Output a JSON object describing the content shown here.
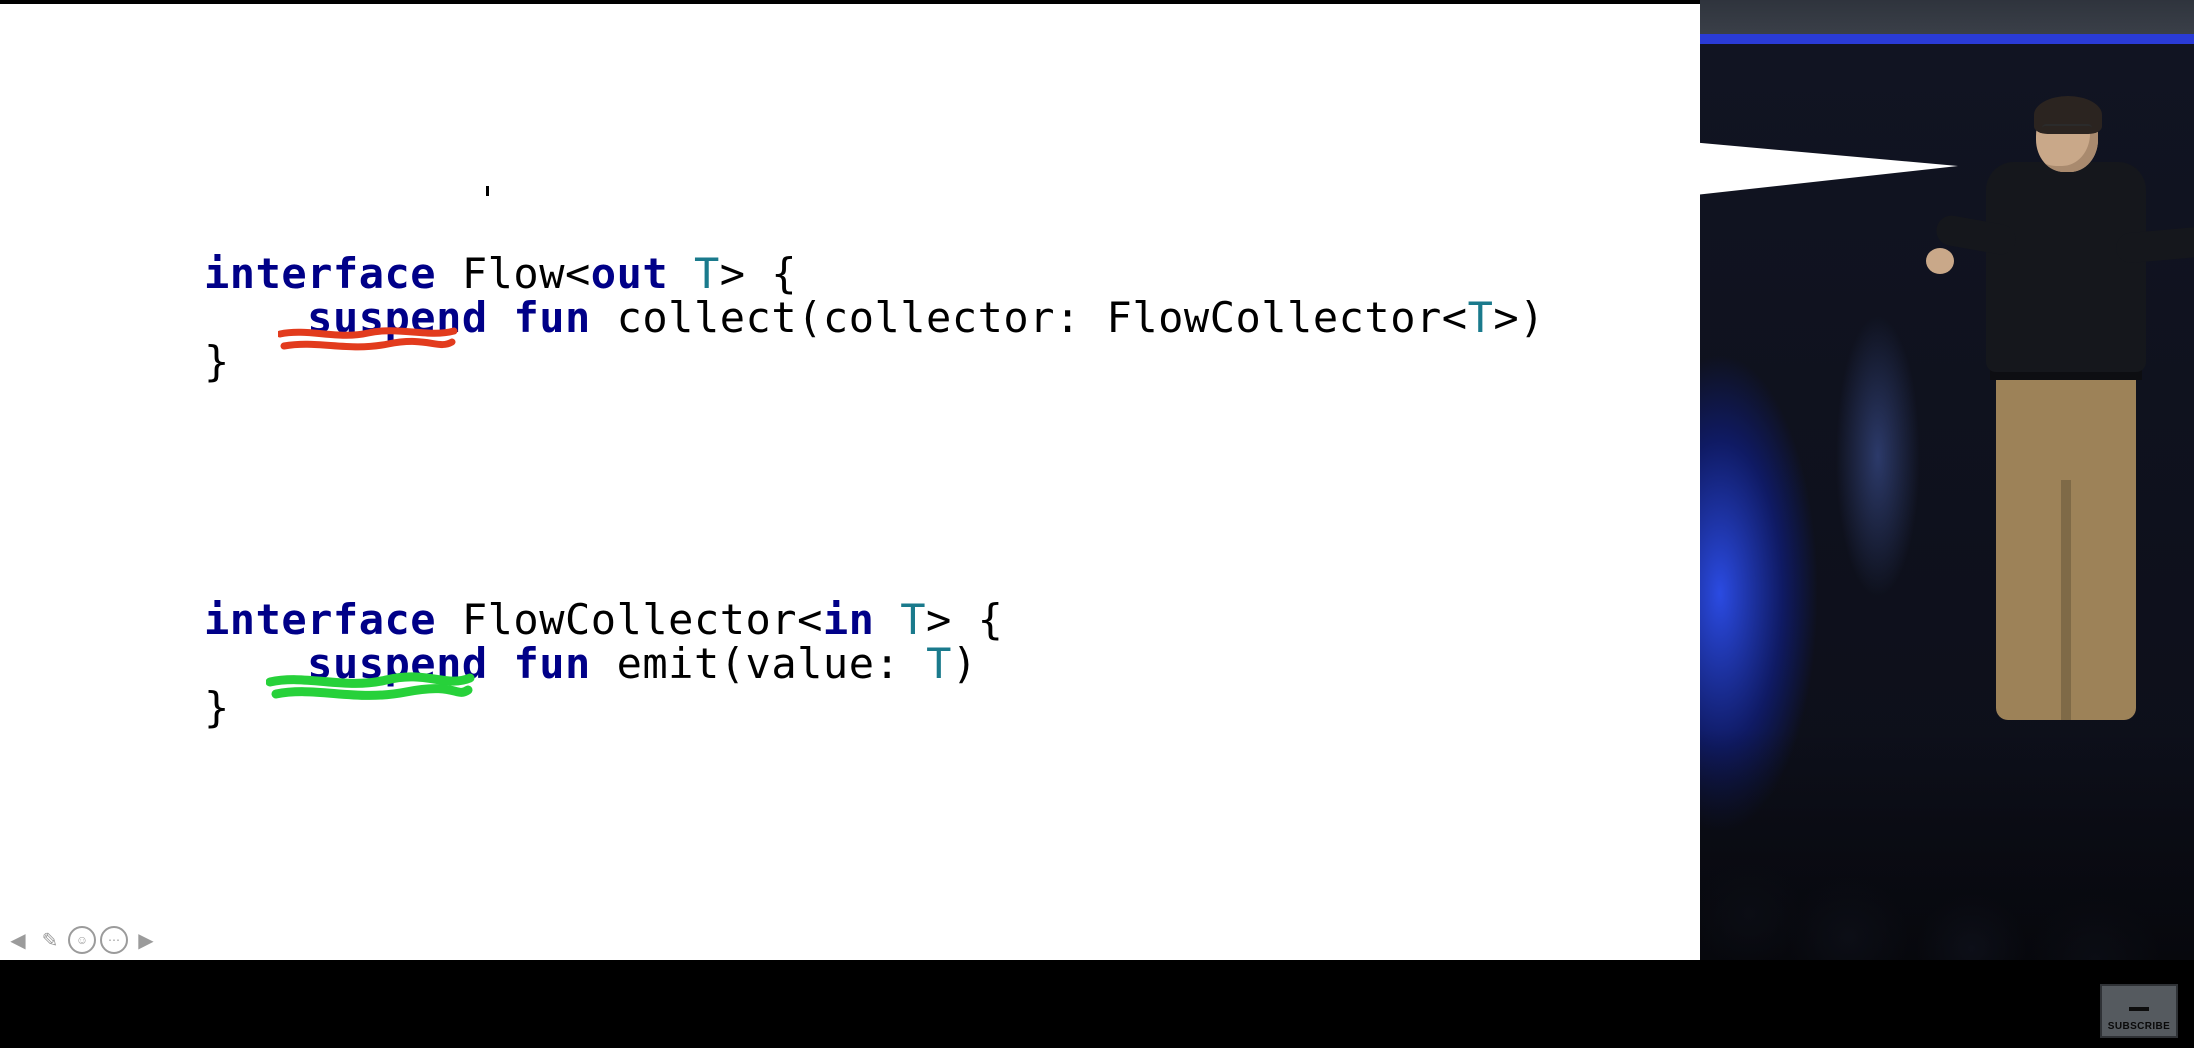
{
  "code_block_1": {
    "line1": {
      "kw1": "interface",
      "name": " Flow<",
      "kw2": "out",
      "tparam": " T",
      "rest": "> {"
    },
    "line2": {
      "indent": "    ",
      "kw1": "suspend",
      "sep1": " ",
      "kw2": "fun",
      "name": " collect(collector: FlowCollector<",
      "tparam": "T",
      "rest": ">)"
    },
    "line3": "}"
  },
  "code_block_2": {
    "line1": {
      "kw1": "interface",
      "name": " FlowCollector<",
      "kw2": "in",
      "tparam": " T",
      "rest": "> {"
    },
    "line2": {
      "indent": "    ",
      "kw1": "suspend",
      "sep1": " ",
      "kw2": "fun",
      "name": " emit(value: ",
      "tparam": "T",
      "rest": ")"
    },
    "line3": "}"
  },
  "annotations": {
    "highlight1_word": "suspend",
    "highlight1_color": "#e23b1d",
    "highlight2_word": "suspend",
    "highlight2_color": "#27d13a"
  },
  "toolbar": {
    "prev": "◀",
    "pen": "✎",
    "menu_inner": "☺",
    "more_inner": "⋯",
    "next": "▶"
  },
  "subscribe_label": "SUBSCRIBE"
}
